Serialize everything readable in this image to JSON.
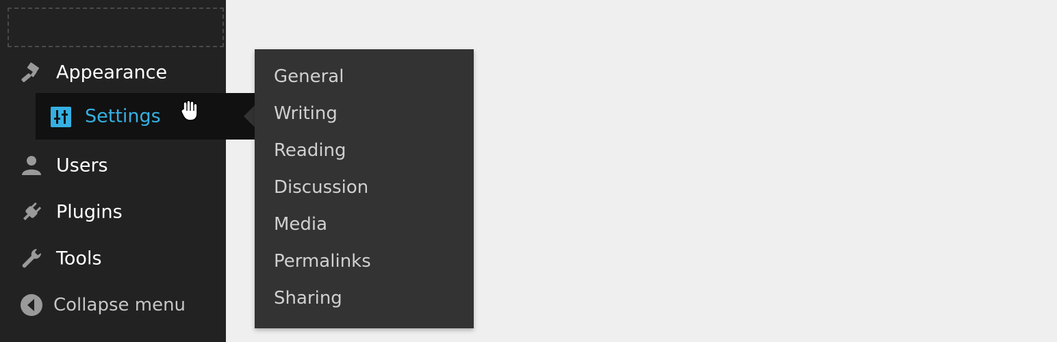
{
  "sidebar": {
    "items": [
      {
        "label": "Appearance",
        "icon": "paintbrush-icon"
      },
      {
        "label": "Settings",
        "icon": "settings-sliders-icon",
        "active": true
      },
      {
        "label": "Users",
        "icon": "user-icon"
      },
      {
        "label": "Plugins",
        "icon": "plug-icon"
      },
      {
        "label": "Tools",
        "icon": "wrench-icon"
      }
    ],
    "collapse_label": "Collapse menu"
  },
  "submenu": {
    "items": [
      "General",
      "Writing",
      "Reading",
      "Discussion",
      "Media",
      "Permalinks",
      "Sharing"
    ]
  },
  "colors": {
    "sidebar_bg": "#222222",
    "active_bg": "#111111",
    "accent": "#35b0e2",
    "submenu_bg": "#333333",
    "page_bg": "#efefef"
  }
}
